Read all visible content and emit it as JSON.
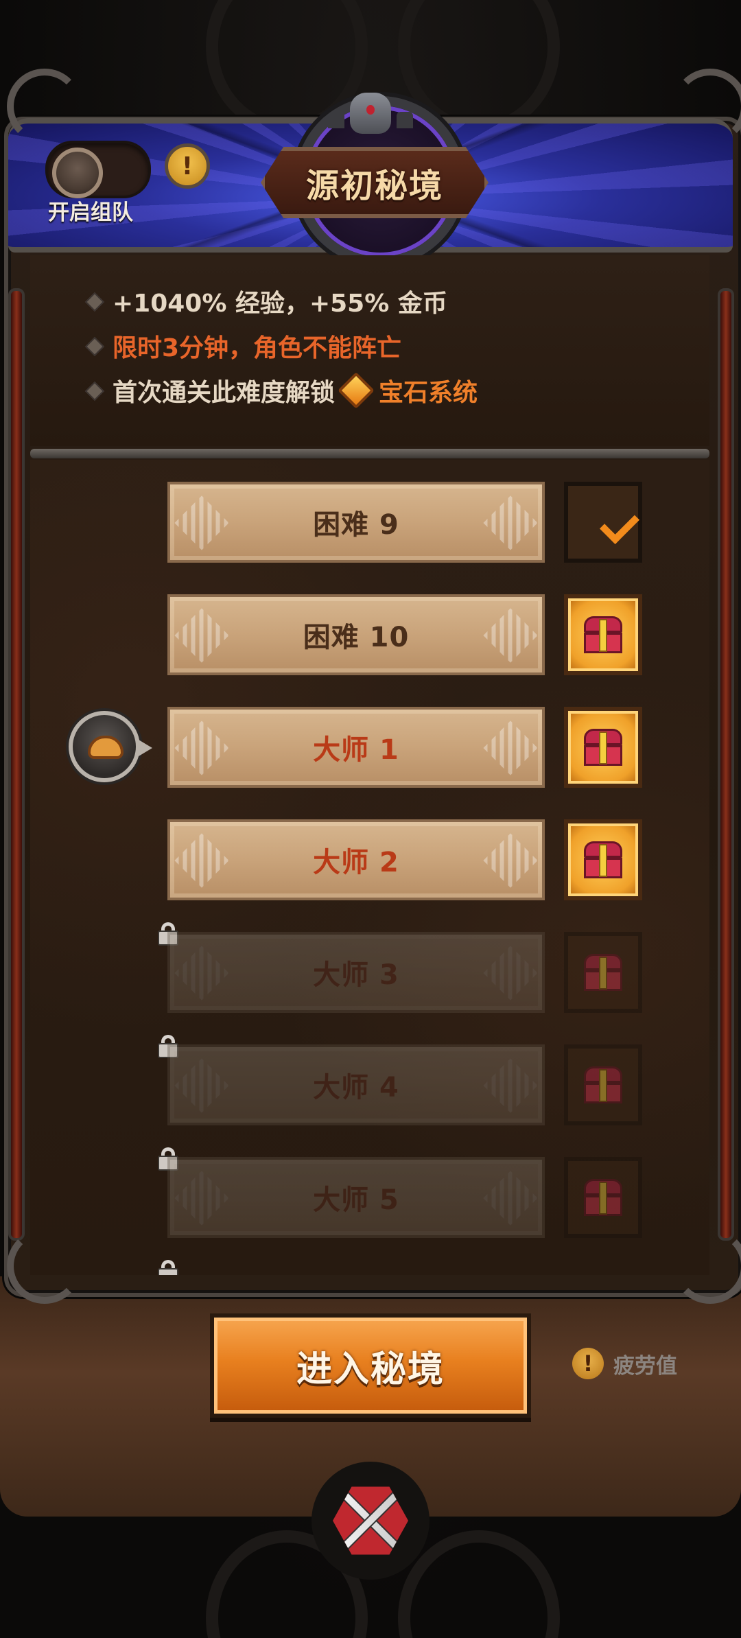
{
  "header": {
    "title": "源初秘境",
    "team_toggle_label": "开启组队",
    "info_glyph": "!"
  },
  "info": {
    "line1": "+1040% 经验，+55% 金币",
    "line2": "限时3分钟，角色不能阵亡",
    "line3_prefix": "首次通关此难度解锁",
    "line3_highlight": "宝石系统"
  },
  "colors": {
    "info_primary": "#e6d8c4",
    "info_alert": "#e8652a",
    "info_highlight": "#f0802a"
  },
  "levels": [
    {
      "label": "困难 9",
      "tier": "hard",
      "locked": false,
      "chest": "claimed"
    },
    {
      "label": "困难 10",
      "tier": "hard",
      "locked": false,
      "chest": "available"
    },
    {
      "label": "大师 1",
      "tier": "master",
      "locked": false,
      "chest": "available",
      "current": true
    },
    {
      "label": "大师 2",
      "tier": "master",
      "locked": false,
      "chest": "available"
    },
    {
      "label": "大师 3",
      "tier": "master",
      "locked": true,
      "chest": "locked"
    },
    {
      "label": "大师 4",
      "tier": "master",
      "locked": true,
      "chest": "locked"
    },
    {
      "label": "大师 5",
      "tier": "master",
      "locked": true,
      "chest": "locked"
    }
  ],
  "actions": {
    "enter_label": "进入秘境",
    "fatigue_label": "疲劳值",
    "fatigue_glyph": "!"
  }
}
